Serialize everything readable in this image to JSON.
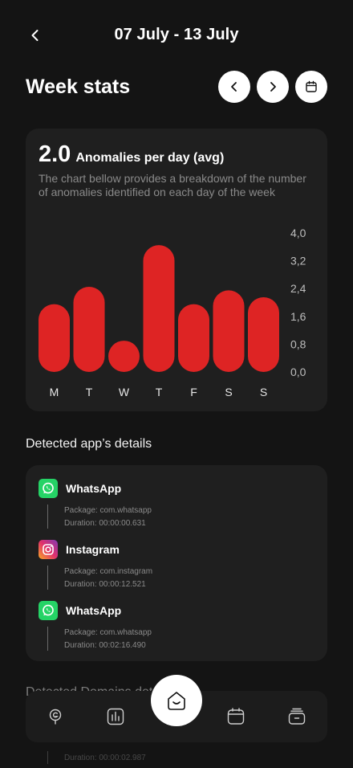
{
  "header": {
    "title": "07 July - 13 July"
  },
  "week": {
    "title": "Week stats"
  },
  "stats": {
    "value": "2.0",
    "label": "Anomalies per day (avg)",
    "description": "The chart bellow provides a breakdown of the number of anomalies identified on each day of the week"
  },
  "chart_data": {
    "type": "bar",
    "categories": [
      "M",
      "T",
      "W",
      "T",
      "F",
      "S",
      "S"
    ],
    "values": [
      1.95,
      2.45,
      0.9,
      3.65,
      1.95,
      2.35,
      2.15
    ],
    "ylim": [
      0,
      4.0
    ],
    "yticks": [
      "4,0",
      "3,2",
      "2,4",
      "1,6",
      "0,8",
      "0,0"
    ],
    "bar_color": "#de2424",
    "title": "",
    "xlabel": "",
    "ylabel": ""
  },
  "apps_section": {
    "title": "Detected app’s details"
  },
  "apps": [
    {
      "name": "WhatsApp",
      "package": "Package: com.whatsapp",
      "duration": "Duration: 00:00:00.631",
      "icon": "whatsapp-icon",
      "color": "#25d366"
    },
    {
      "name": "Instagram",
      "package": "Package: com.instagram",
      "duration": "Duration: 00:00:12.521",
      "icon": "instagram-icon",
      "color": "#d6249f"
    },
    {
      "name": "WhatsApp",
      "package": "Package: com.whatsapp",
      "duration": "Duration: 00:02:16.490",
      "icon": "whatsapp-icon",
      "color": "#25d366"
    }
  ],
  "next_section": {
    "title": "Detected Domains details"
  },
  "faded_duration": "Duration: 00:00:02.987",
  "nav": [
    "mic-icon",
    "stats-icon",
    "home-icon",
    "calendar-icon",
    "archive-icon"
  ]
}
